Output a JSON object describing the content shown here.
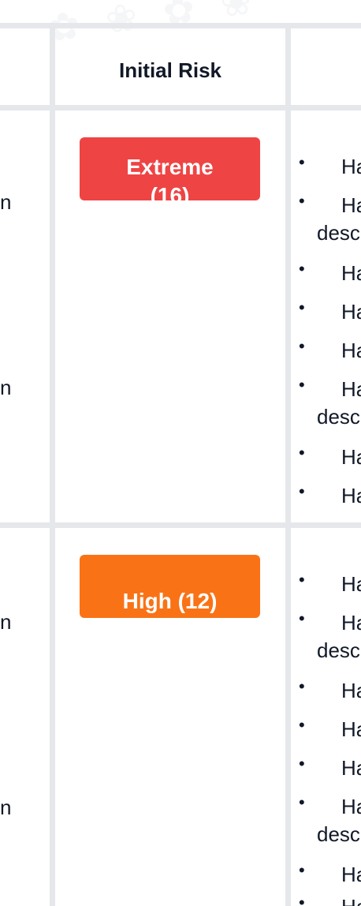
{
  "table": {
    "header": {
      "initial_risk": "Initial Risk"
    },
    "rows": [
      {
        "risk_label": "Extreme (16)",
        "risk_color": "#ef4444",
        "left_fragments": [
          "n",
          "n"
        ],
        "bullets": [
          "Ha",
          "Ha",
          "Ha",
          "Ha",
          "Ha",
          "Ha",
          "Ha",
          "Ha"
        ],
        "continuations": [
          "desc",
          "desc"
        ]
      },
      {
        "risk_label": "High (12)",
        "risk_color": "#f97316",
        "left_fragments": [
          "n",
          "n"
        ],
        "bullets": [
          "Ha",
          "Ha",
          "Ha",
          "Ha",
          "Ha",
          "Ha",
          "Ha",
          "Ha"
        ],
        "continuations": [
          "desc",
          "desc"
        ]
      }
    ]
  }
}
